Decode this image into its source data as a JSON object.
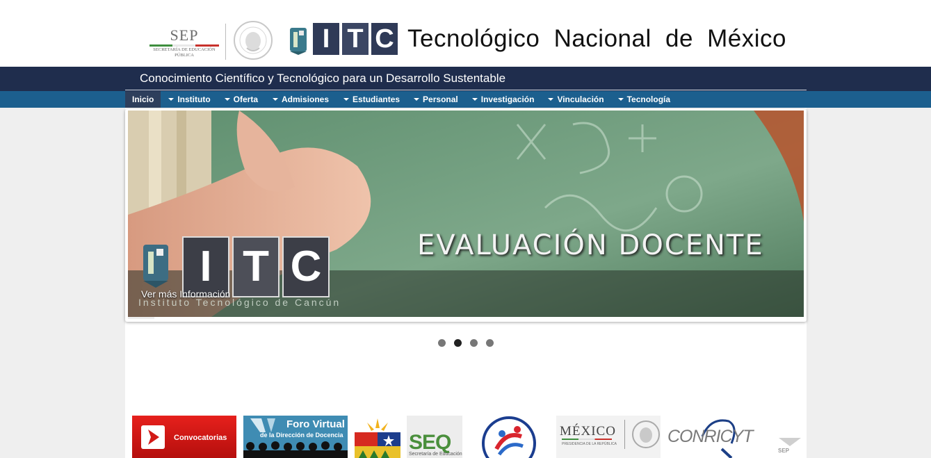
{
  "header": {
    "sep": {
      "title": "SEP",
      "subtitle": "SECRETARÍA DE EDUCACIÓN PÚBLICA"
    },
    "itc_letters": [
      "I",
      "T",
      "C"
    ],
    "title": "Tecnológico Nacional de México",
    "slogan": "Conocimiento Científico y Tecnológico para un  Desarrollo Sustentable"
  },
  "nav": {
    "items": [
      {
        "label": "Inicio",
        "active": true,
        "has_dropdown": false
      },
      {
        "label": "Instituto",
        "active": false,
        "has_dropdown": true
      },
      {
        "label": "Oferta",
        "active": false,
        "has_dropdown": true
      },
      {
        "label": "Admisiones",
        "active": false,
        "has_dropdown": true
      },
      {
        "label": "Estudiantes",
        "active": false,
        "has_dropdown": true
      },
      {
        "label": "Personal",
        "active": false,
        "has_dropdown": true
      },
      {
        "label": "Investigación",
        "active": false,
        "has_dropdown": true
      },
      {
        "label": "Vinculación",
        "active": false,
        "has_dropdown": true
      },
      {
        "label": "Tecnología",
        "active": false,
        "has_dropdown": true
      }
    ]
  },
  "slider": {
    "heading": "EVALUACIÓN DOCENTE",
    "caption": "Ver más Información",
    "school_name": "Instituto Tecnológico de Cancún",
    "itc_letters": [
      "I",
      "T",
      "C"
    ],
    "dots": [
      {
        "active": false
      },
      {
        "active": true
      },
      {
        "active": false
      },
      {
        "active": false
      }
    ]
  },
  "banners": {
    "convocatorias": "Convocatorias",
    "foro_title": "Foro Virtual",
    "foro_sub": "de la Dirección de Docencia",
    "seq": "SEQ",
    "seq_sub": "Secretaría de Educación",
    "mexico": "MÉXICO",
    "mexico_sub": "PRESIDENCIA DE LA REPÚBLICA",
    "conricyt": "CONRICYT",
    "sep_small": "SEP"
  },
  "colors": {
    "slogan_bar": "#1f2d4d",
    "nav_bar": "#1c5f8e",
    "nav_active": "#2e3f5c",
    "itc_box": "#2f3a57"
  }
}
